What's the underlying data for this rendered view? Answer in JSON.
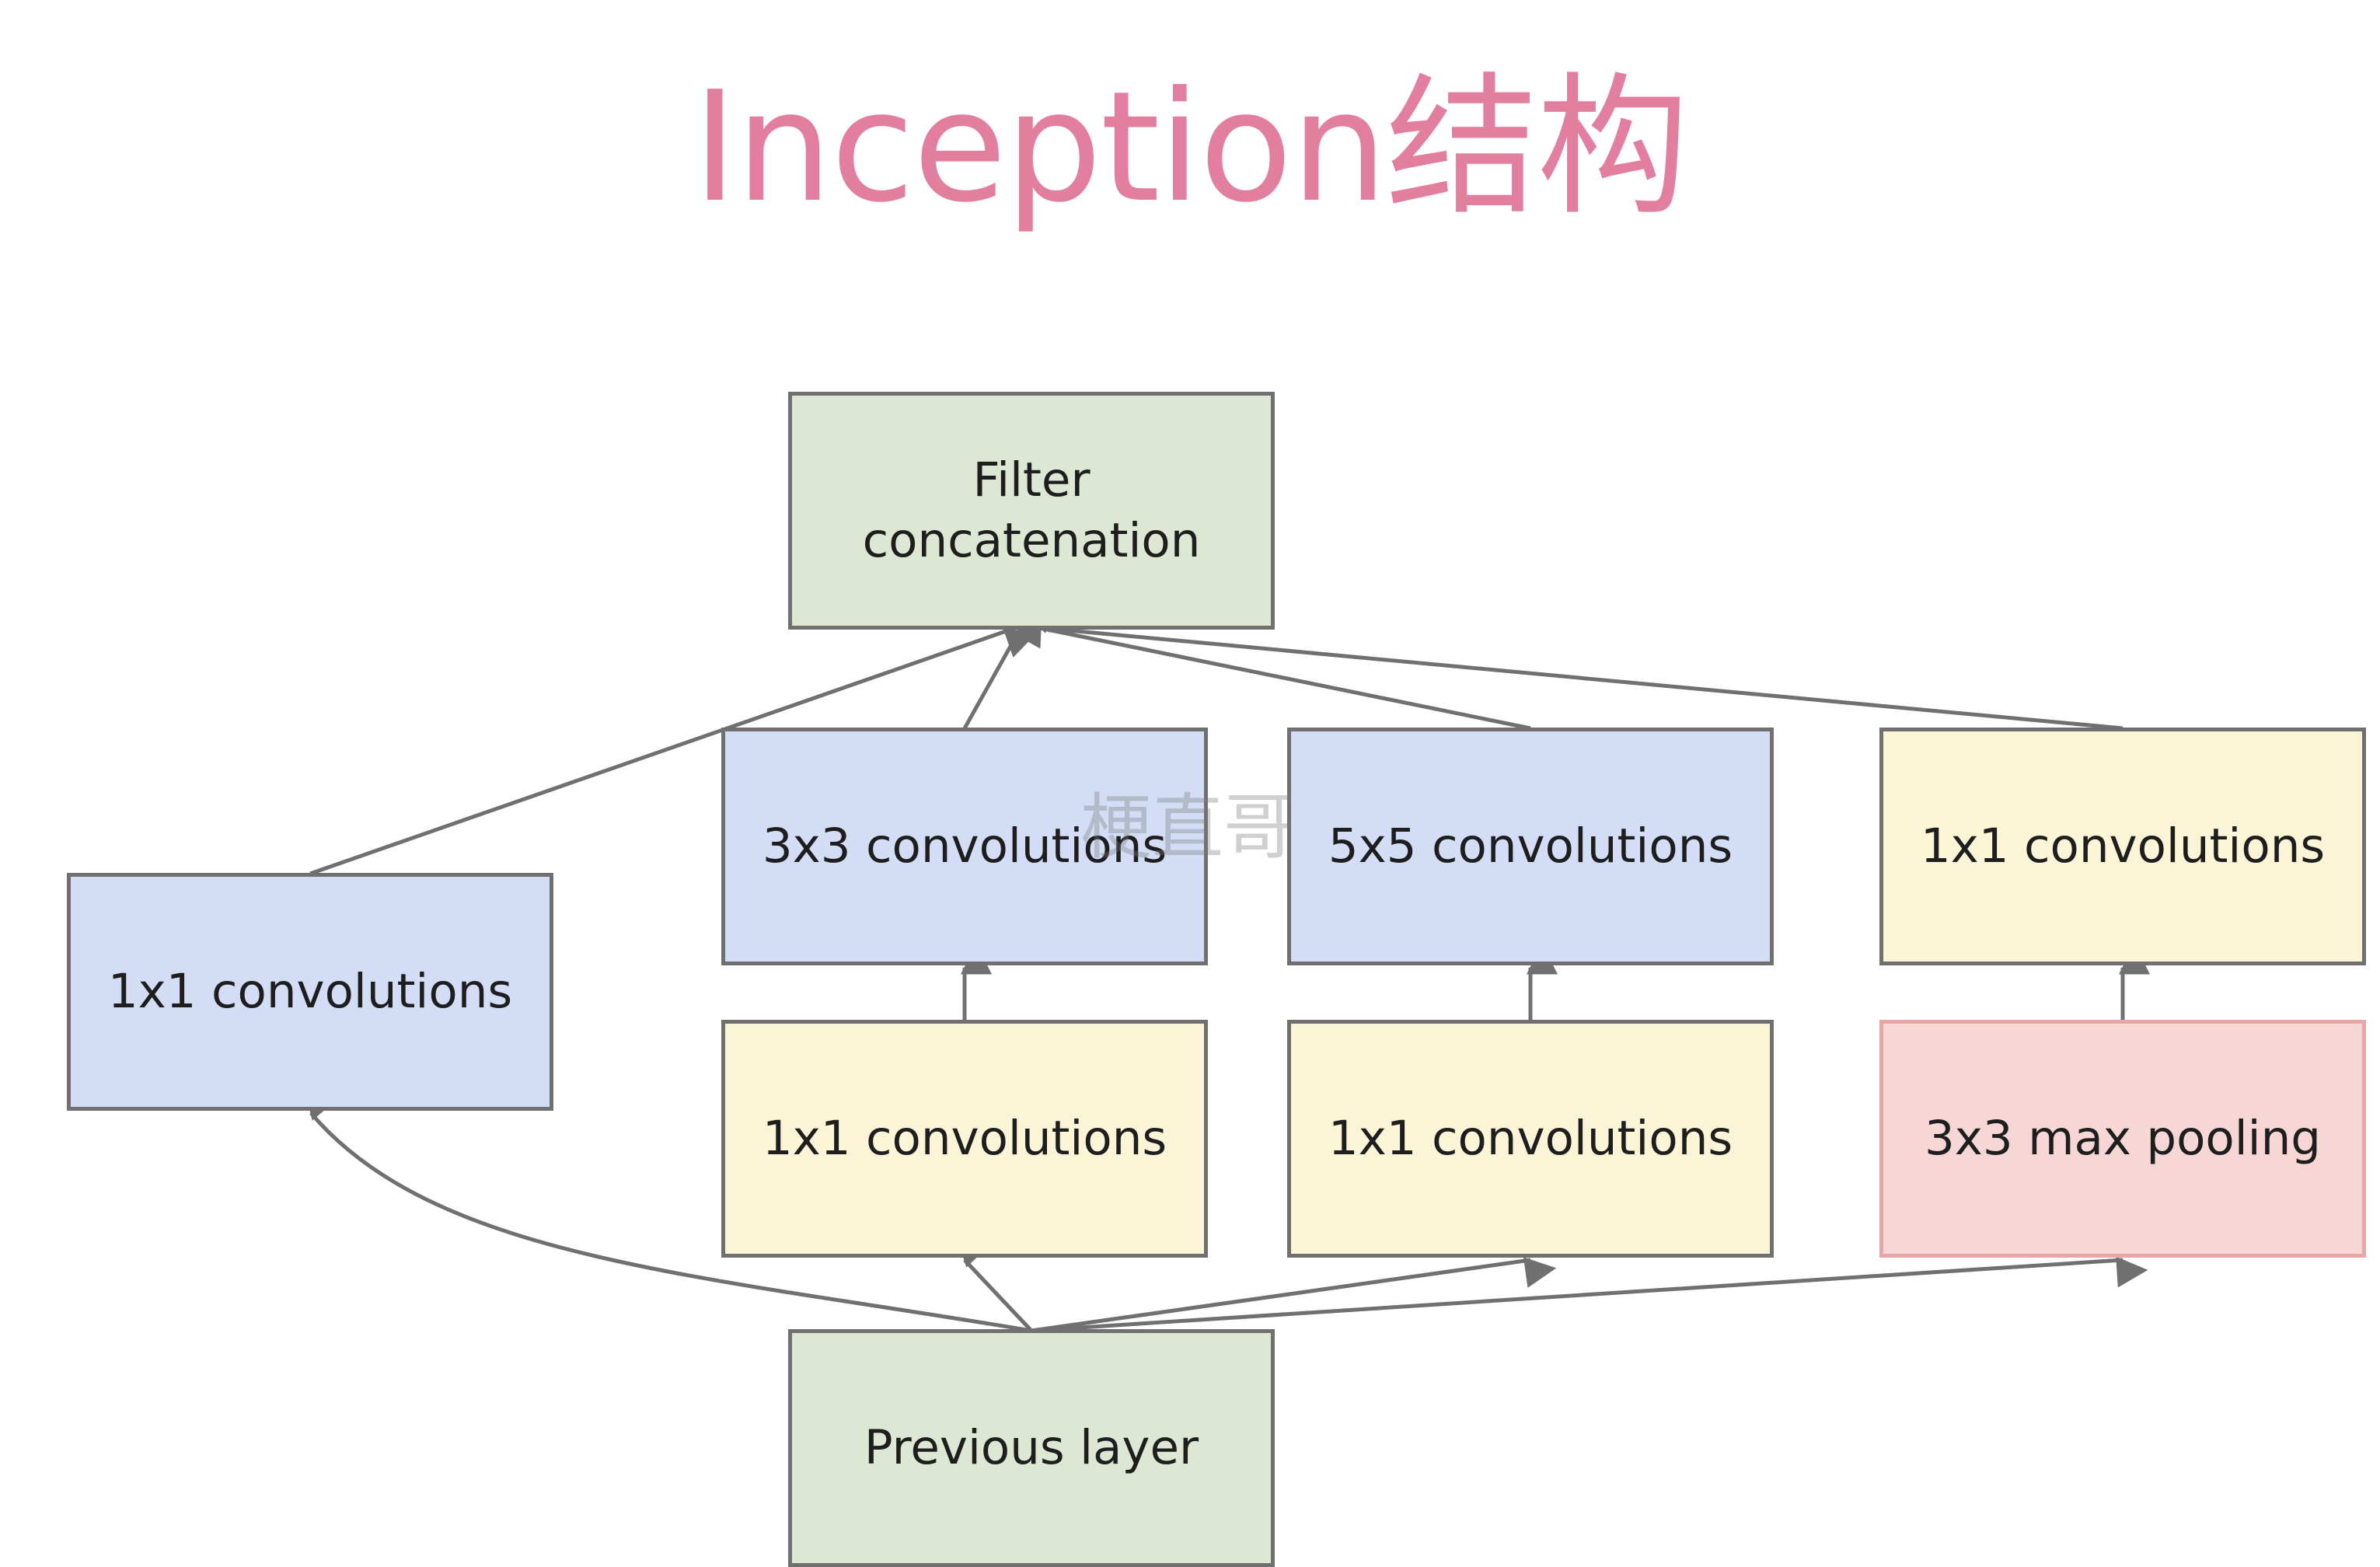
{
  "title": "Inception结构",
  "watermark": "梗直哥",
  "colors": {
    "title": "#e27f9e",
    "green": "#dce8d4",
    "blue": "#d3def6",
    "yellow": "#fcf4d6",
    "pink": "#f6d7d5",
    "border": "#707070",
    "pink_border": "#e8a7a7",
    "edge": "#707070"
  },
  "nodes": [
    {
      "id": "filter-concat",
      "label": "Filter\nconcatenation",
      "color": "green"
    },
    {
      "id": "conv1x1-left",
      "label": "1x1 convolutions",
      "color": "blue"
    },
    {
      "id": "conv3x3",
      "label": "3x3 convolutions",
      "color": "blue"
    },
    {
      "id": "conv5x5",
      "label": "5x5 convolutions",
      "color": "blue"
    },
    {
      "id": "conv1x1-right-top",
      "label": "1x1 convolutions",
      "color": "yellow"
    },
    {
      "id": "conv1x1-reduce-3x3",
      "label": "1x1 convolutions",
      "color": "yellow"
    },
    {
      "id": "conv1x1-reduce-5x5",
      "label": "1x1 convolutions",
      "color": "yellow"
    },
    {
      "id": "maxpool3x3",
      "label": "3x3 max pooling",
      "color": "pink"
    },
    {
      "id": "previous-layer",
      "label": "Previous layer",
      "color": "green"
    }
  ],
  "edges": [
    {
      "from": "previous-layer",
      "to": "conv1x1-left"
    },
    {
      "from": "previous-layer",
      "to": "conv1x1-reduce-3x3"
    },
    {
      "from": "previous-layer",
      "to": "conv1x1-reduce-5x5"
    },
    {
      "from": "previous-layer",
      "to": "maxpool3x3"
    },
    {
      "from": "conv1x1-reduce-3x3",
      "to": "conv3x3"
    },
    {
      "from": "conv1x1-reduce-5x5",
      "to": "conv5x5"
    },
    {
      "from": "maxpool3x3",
      "to": "conv1x1-right-top"
    },
    {
      "from": "conv1x1-left",
      "to": "filter-concat"
    },
    {
      "from": "conv3x3",
      "to": "filter-concat"
    },
    {
      "from": "conv5x5",
      "to": "filter-concat"
    },
    {
      "from": "conv1x1-right-top",
      "to": "filter-concat"
    }
  ]
}
